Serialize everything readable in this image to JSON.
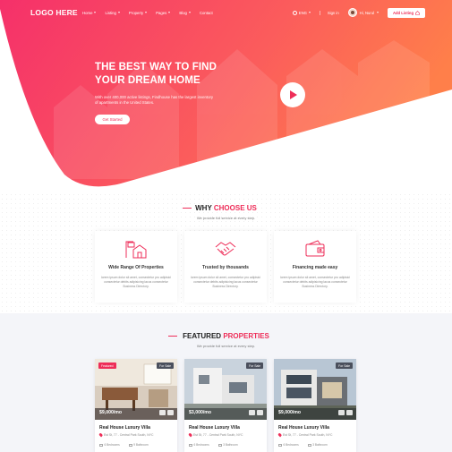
{
  "brand": {
    "logo": "LOGO HERE",
    "accent": "#ee2d58",
    "gradient": [
      "#f0356a",
      "#ff7a45"
    ]
  },
  "nav": {
    "items": [
      {
        "label": "Home",
        "dropdown": true
      },
      {
        "label": "Listing",
        "dropdown": true
      },
      {
        "label": "Property",
        "dropdown": true
      },
      {
        "label": "Pages",
        "dropdown": true
      },
      {
        "label": "Blog",
        "dropdown": true
      },
      {
        "label": "Contact",
        "dropdown": false
      }
    ],
    "language": "ENG",
    "signin": "Sign in",
    "user": "Hi, Nurul",
    "add_listing": "Add Listing",
    "icons": {
      "language": "globe-icon",
      "add_listing": "home-plus-icon",
      "caret": "chevron-down-icon"
    }
  },
  "hero": {
    "title": "THE BEST WAY TO FIND YOUR DREAM HOME",
    "subtitle": "With over 400,000 active listings, Findhouse has the largest inventory of apartments in the United States.",
    "cta": "Get Started",
    "play_icon": "play-icon"
  },
  "why": {
    "title_plain": "WHY",
    "title_accent": "CHOOSE US",
    "subtitle": "We provide full service at every step.",
    "features": [
      {
        "icon": "house-sign-icon",
        "title": "Wide Range Of Properties",
        "desc": "lorem ipsum dolor sit amet, consectetur pro adipisici consectetur debits adipisicing lacus consectetur Business Directory."
      },
      {
        "icon": "handshake-icon",
        "title": "Trusted by thousands",
        "desc": "lorem ipsum dolor sit amet, consectetur pro adipisici consectetur debits adipisicing lacus consectetur Business Directory."
      },
      {
        "icon": "wallet-icon",
        "title": "Financing made easy",
        "desc": "lorem ipsum dolor sit amet, consectetur pro adipisici consectetur debits adipisicing lacus consectetur Business Directory."
      }
    ]
  },
  "featured": {
    "title_plain": "FEATURED",
    "title_accent": "PROPERTIES",
    "subtitle": "We provide full service at every step.",
    "cards": [
      {
        "featured_badge": "Featured",
        "status": "For Sale",
        "price": "$9,000/mo",
        "title": "Real House Luxury Villa",
        "address": "Est St, 77 - Central Park South, NYC",
        "beds": "6 Bedrooms",
        "baths": "9 Bathroom"
      },
      {
        "featured_badge": "",
        "status": "For Sale",
        "price": "$3,000/mo",
        "title": "Real House Luxury Villa",
        "address": "Est St, 77 - Central Park South, NYC",
        "beds": "6 Bedrooms",
        "baths": "3 Bathroom"
      },
      {
        "featured_badge": "",
        "status": "For Sale",
        "price": "$9,000/mo",
        "title": "Real House Luxury Villa",
        "address": "Est St, 77 - Central Park South, NYC",
        "beds": "6 Bedrooms",
        "baths": "3 Bathroom"
      }
    ]
  }
}
